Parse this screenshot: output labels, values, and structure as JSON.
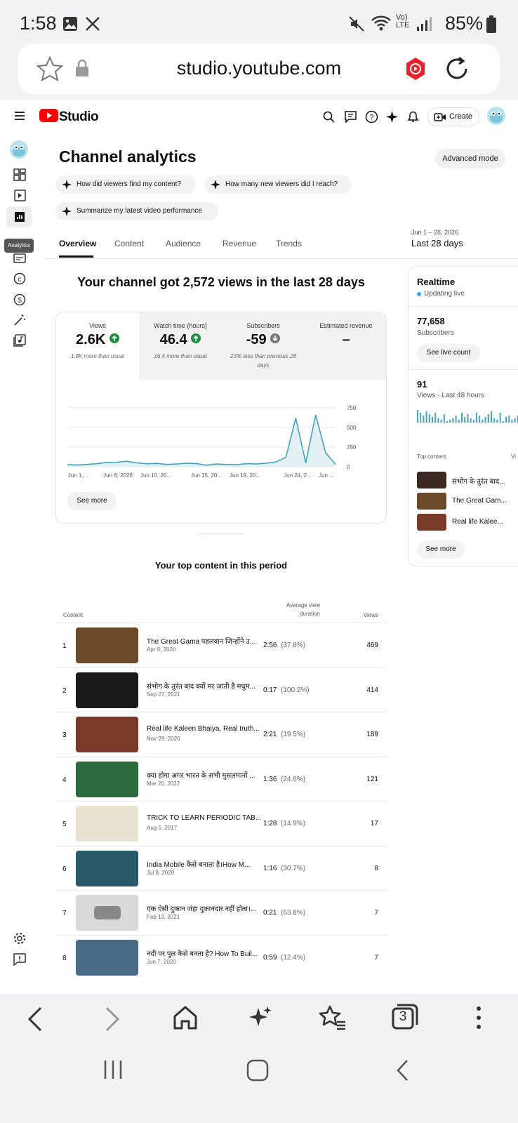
{
  "status": {
    "time": "1:58",
    "battery": "85%",
    "network": "Vo) LTE"
  },
  "browser": {
    "url": "studio.youtube.com",
    "tab_count": "3"
  },
  "app": {
    "brand": "Studio",
    "create_label": "Create",
    "tooltip": "Analytics"
  },
  "page": {
    "title": "Channel analytics",
    "advanced_label": "Advanced mode",
    "chips": [
      "How did viewers find my content?",
      "How many new viewers did I reach?",
      "Summarize my latest video performance"
    ],
    "tabs": [
      "Overview",
      "Content",
      "Audience",
      "Revenue",
      "Trends"
    ],
    "date_small": "Jun 1 – 28, 2026",
    "date_big": "Last 28 days",
    "headline": "Your channel got 2,572 views in the last 28 days"
  },
  "metrics": [
    {
      "label": "Views",
      "value": "2.6K",
      "trend": "up",
      "sub": "1.8K more than usual"
    },
    {
      "label": "Watch time (hours)",
      "value": "46.4",
      "trend": "up",
      "sub": "16.4 more than usual"
    },
    {
      "label": "Subscribers",
      "value": "-59",
      "trend": "down",
      "sub": "23% less than previous 28 days"
    },
    {
      "label": "Estimated revenue",
      "value": "–",
      "trend": "none",
      "sub": ""
    }
  ],
  "chart_data": {
    "type": "line",
    "x_ticks": [
      "Jun 1,...",
      "Jun 6, 2026",
      "Jun 10, 20...",
      "Jun 15, 20...",
      "Jun 19, 20...",
      "Jun 24, 2...",
      "Jun ..."
    ],
    "y_ticks": [
      "750",
      "500",
      "250",
      "0"
    ],
    "ylim": [
      0,
      750
    ],
    "values": [
      28,
      22,
      30,
      40,
      55,
      58,
      70,
      50,
      38,
      42,
      30,
      35,
      45,
      40,
      20,
      35,
      30,
      25,
      40,
      35,
      45,
      60,
      120,
      620,
      50,
      660,
      180,
      30
    ],
    "see_more": "See more"
  },
  "realtime": {
    "title": "Realtime",
    "live": "Updating live",
    "subs_value": "77,658",
    "subs_label": "Subscribers",
    "live_count_btn": "See live count",
    "views_value": "91",
    "views_label": "Views · Last 48 hours",
    "top_label": "Top content",
    "views_col": "Vi",
    "bars": [
      18,
      14,
      10,
      16,
      12,
      8,
      14,
      6,
      4,
      12,
      2,
      4,
      6,
      10,
      4,
      14,
      8,
      12,
      6,
      4,
      14,
      10,
      4,
      8,
      12,
      16,
      6,
      4,
      14,
      2,
      8,
      10,
      4,
      6,
      10,
      4,
      12
    ],
    "items": [
      "संभोग के तुरंत बाद...",
      "The Great Gam...",
      "Real life Kalee..."
    ],
    "see_more": "See more"
  },
  "top_content": {
    "title": "Your top content in this period",
    "col_content": "Content",
    "col_duration": "Average view duration",
    "col_views": "Views",
    "rows": [
      {
        "rank": "1",
        "title": "The Great Gama पहलवान जिन्होंने उ...",
        "date": "Apr 9, 2020",
        "duration": "2:56",
        "pct": "(37.8%)",
        "views": "469",
        "thumb": "#6b4a2a"
      },
      {
        "rank": "2",
        "title": "संभोग के तुरंत बाद क्यों मर जाती है मधुम...",
        "date": "Sep 27, 2021",
        "duration": "0:17",
        "pct": "(100.2%)",
        "views": "414",
        "thumb": "#1a1a1a"
      },
      {
        "rank": "3",
        "title": "Real life Kaleen Bhaiya, Real truth...",
        "date": "Nov 29, 2020",
        "duration": "2:21",
        "pct": "(19.5%)",
        "views": "189",
        "thumb": "#7a3a2a"
      },
      {
        "rank": "4",
        "title": "क्या होगा अगर भारत के सभी मुसलमानों ...",
        "date": "Mar 20, 2022",
        "duration": "1:36",
        "pct": "(24.6%)",
        "views": "121",
        "thumb": "#2b6a3a"
      },
      {
        "rank": "5",
        "title": "TRICK TO LEARN PERIODIC TAB...",
        "date": "Aug 5, 2017",
        "duration": "1:28",
        "pct": "(14.9%)",
        "views": "17",
        "thumb": "#e8e2d2"
      },
      {
        "rank": "6",
        "title": "India Mobile कैसे बनाता है।How M...",
        "date": "Jul 8, 2020",
        "duration": "1:16",
        "pct": "(30.7%)",
        "views": "8",
        "thumb": "#2a5a6a"
      },
      {
        "rank": "7",
        "title": "एक ऐसी दुकान जंहा दुकानदार नहीं होता।...",
        "date": "Feb 13, 2021",
        "duration": "0:21",
        "pct": "(63.8%)",
        "views": "7",
        "thumb": "#d9d9d9"
      },
      {
        "rank": "8",
        "title": "नदी पर पुल कैसे बनता है? How To Buil...",
        "date": "Jun 7, 2020",
        "duration": "0:59",
        "pct": "(12.4%)",
        "views": "7",
        "thumb": "#4a6a8a"
      }
    ]
  },
  "colors": {
    "brand_red": "#ff0000",
    "chart_line": "#41a3be",
    "chart_fill": "#e3f1f5",
    "positive": "#1e8e3e",
    "down": "#777777"
  }
}
